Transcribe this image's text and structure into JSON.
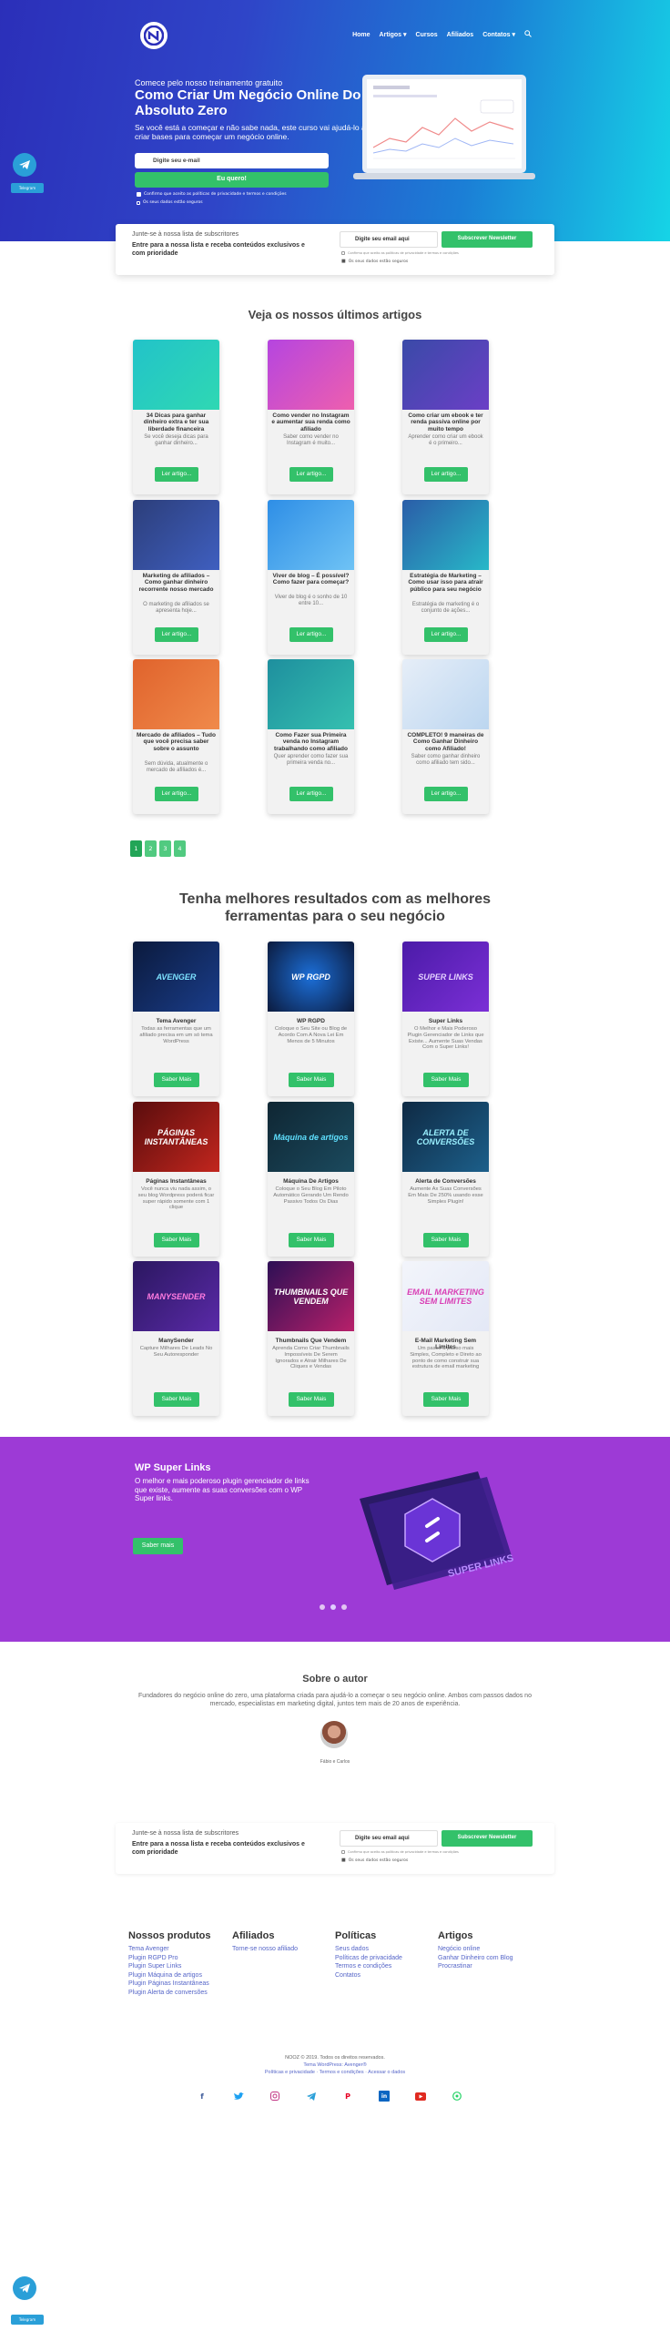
{
  "header": {
    "nav": [
      "Home",
      "Artigos ▾",
      "Cursos",
      "Afiliados",
      "Contatos ▾"
    ]
  },
  "hero": {
    "kicker": "Comece pelo nosso treinamento gratuito",
    "title": "Como Criar Um Negócio Online Do Absoluto Zero",
    "subtitle": "Se você está a começar e não sabe nada, este curso vai ajudá-lo a criar bases para começar um negócio online.",
    "email_placeholder": "Digite seu e-mail",
    "cta": "Eu quero!",
    "consent": "Confirmo que aceito as políticas de privacidade e termos e condições",
    "safe_note": "Os seus dados estão seguros",
    "telegram_badge": "Telegram"
  },
  "subscribe": {
    "line1": "Junte-se à nossa lista de subscritores",
    "line2": "Entre para a nossa lista e receba conteúdos exclusivos e com prioridade",
    "placeholder": "Digite seu email aqui",
    "button": "Subscrever Newsletter",
    "consent": "Confirmo que aceito as políticas de privacidade e termos e condições",
    "safe": "Os seus dados estão seguros"
  },
  "articles": {
    "title": "Veja os nossos últimos artigos",
    "button": "Ler artigo...",
    "items": [
      {
        "title": "34 Dicas para ganhar dinheiro extra e ter sua liberdade financeira",
        "desc": "Se você deseja dicas para ganhar dinheiro..."
      },
      {
        "title": "Como vender no Instagram e aumentar sua renda como afiliado",
        "desc": "Saber como vender no Instagram é muito..."
      },
      {
        "title": "Como criar um ebook e ter renda passiva online por muito tempo",
        "desc": "Aprender como criar um ebook é o primeiro..."
      },
      {
        "title": "Marketing de afiliados – Como ganhar dinheiro recorrente nosso mercado",
        "desc": "O marketing de afiliados se apresenta hoje..."
      },
      {
        "title": "Viver de blog – É possível? Como fazer para começar?",
        "desc": "Viver de blog é o sonho de 10 entre 10..."
      },
      {
        "title": "Estratégia de Marketing – Como usar isso para atrair público para seu negócio",
        "desc": "Estratégia de marketing é o conjunto de ações..."
      },
      {
        "title": "Mercado de afiliados – Tudo que você precisa saber sobre o assunto",
        "desc": "Sem dúvida, atualmente o mercado de afiliados é..."
      },
      {
        "title": "Como Fazer sua Primeira venda no Instagram trabalhando como afiliado",
        "desc": "Quer aprender como fazer sua primeira venda no..."
      },
      {
        "title": "COMPLETO! 9 maneiras de Como Ganhar Dinheiro como Afiliado!",
        "desc": "Saber como ganhar dinheiro como afiliado tem sido..."
      }
    ]
  },
  "pagination": [
    "1",
    "2",
    "3",
    "4"
  ],
  "tools": {
    "title": "Tenha melhores resultados com as melhores ferramentas para o seu negócio",
    "button": "Saber Mais",
    "items": [
      {
        "title": "Tema Avenger",
        "desc": "Todas as ferramentas que um afiliado precisa em um só tema WordPress",
        "art": "AVENGER"
      },
      {
        "title": "WP RGPD",
        "desc": "Coloque o Seu Site ou Blog de Acordo Com A Nova Lei Em Menos de 5 Minutos",
        "art": "WP RGPD"
      },
      {
        "title": "Super Links",
        "desc": "O Melhor e Mais Poderoso Plugin Gerenciador de Links que Existe... Aumente Suas Vendas Com o Super Links!",
        "art": "SUPER LINKS"
      },
      {
        "title": "Páginas Instantâneas",
        "desc": "Você nunca viu nada assim, o seu blog Wordpress poderá ficar super rápido somente com 1 clique",
        "art": "PÁGINAS INSTANTÂNEAS"
      },
      {
        "title": "Máquina De Artigos",
        "desc": "Coloque o Seu Blog Em Piloto Automático Gerando Um Rendo Passivo Todos Os Dias",
        "art": "Máquina de artigos"
      },
      {
        "title": "Alerta de Conversões",
        "desc": "Aumente Ax Suas Conversões Em Mais De 250% usando esse Simples Plugin!",
        "art": "ALERTA DE CONVERSÕES"
      },
      {
        "title": "ManySender",
        "desc": "Capture Milhares De Leads No Seu Autoresponder",
        "art": "MANYSENDER"
      },
      {
        "title": "Thumbnails Que Vendem",
        "desc": "Aprenda Como Criar Thumbnails Impossíveis De Serem Ignorados e Atrair Milhares De Cliques e Vendas",
        "art": "THUMBNAILS QUE VENDEM"
      },
      {
        "title": "E-Mail Marketing Sem Limites",
        "desc": "Um passo a passo mais Simples, Completo e Direto ao ponto de como construir sua estrutura de email marketing",
        "art": "EMAIL MARKETING SEM LIMITES"
      }
    ]
  },
  "promo": {
    "title": "WP Super Links",
    "desc": "O melhor e mais poderoso plugin gerenciador de links que existe, aumente as suas conversões com o WP Super links.",
    "button": "Saber mais",
    "art": "SUPER LINKS"
  },
  "author": {
    "title": "Sobre o autor",
    "bio": "Fundadores do negócio online do zero, uma plataforma criada para ajudá-lo a começar o seu negócio online. Ambos com passos dados no mercado, especialistas em marketing digital, juntos tem mais de 20 anos de experiência.",
    "names": "Fábio e Carlos"
  },
  "footer": {
    "columns": [
      {
        "title": "Nossos produtos",
        "links": [
          "Tema Avenger",
          "Plugin RGPD Pro",
          "Plugin Super Links",
          "Plugin Máquina de artigos",
          "Plugin Páginas Instantâneas",
          "Plugin Alerta de conversões"
        ]
      },
      {
        "title": "Afiliados",
        "links": [
          "Torne-se nosso afiliado"
        ]
      },
      {
        "title": "Políticas",
        "links": [
          "Seus dados",
          "Políticas de privacidade",
          "Termos e condições",
          "Contatos"
        ]
      },
      {
        "title": "Artigos",
        "links": [
          "Negócio online",
          "Ganhar Dinheiro com Blog",
          "Procrastinar"
        ]
      }
    ],
    "copy1": "NOOZ © 2019. Todos os direitos reservados.",
    "copy2": "Tema WordPress: Avenger®",
    "copy3": "Políticas e privacidade · Termos e condições · Acessar o dados",
    "social": [
      "facebook-icon",
      "twitter-icon",
      "instagram-icon",
      "telegram-icon",
      "pinterest-icon",
      "linkedin-icon",
      "youtube-icon",
      "whatsapp-icon"
    ]
  },
  "colors": {
    "green": "#33c16a",
    "purple": "#9d3ad6",
    "blue": "#2b2fb9",
    "cyan": "#16d4e6"
  }
}
